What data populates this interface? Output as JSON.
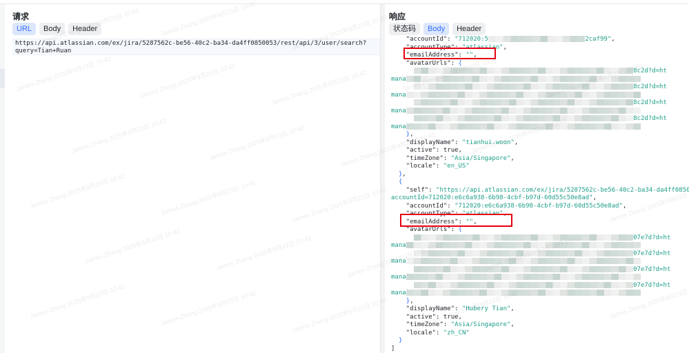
{
  "request": {
    "title": "请求",
    "tabs": [
      {
        "label": "URL",
        "active": true
      },
      {
        "label": "Body",
        "active": false
      },
      {
        "label": "Header",
        "active": false
      }
    ],
    "url_lines": [
      "https://api.atlassian.com/ex/jira/5287562c-be56-40c2-ba34-da4ff0850053/rest/api/3/user/search?",
      "query=Tian+Ruan"
    ]
  },
  "response": {
    "title": "响应",
    "tabs": [
      {
        "label": "状态码",
        "active": false
      },
      {
        "label": "Body",
        "active": true
      },
      {
        "label": "Header",
        "active": false
      }
    ],
    "lines": [
      {
        "id": "l1",
        "indent": "    ",
        "parts": [
          {
            "c": "key",
            "t": "\"accountId\": "
          },
          {
            "c": "str",
            "t": "\"712020:5"
          },
          {
            "c": "blur",
            "t": "xxxxxxxxxxxxxxxxxxxxxxxxxx"
          },
          {
            "c": "str",
            "t": "2caf99\""
          },
          {
            "c": "punc",
            "t": ","
          }
        ]
      },
      {
        "id": "l2",
        "indent": "    ",
        "parts": [
          {
            "c": "key",
            "t": "\"accountType\": "
          },
          {
            "c": "str",
            "t": "\"atlassian\""
          },
          {
            "c": "punc",
            "t": ","
          }
        ]
      },
      {
        "id": "l3",
        "indent": "    ",
        "parts": [
          {
            "c": "key",
            "t": "\"emailAddress\": "
          },
          {
            "c": "str",
            "t": "\"\""
          },
          {
            "c": "punc",
            "t": ","
          }
        ]
      },
      {
        "id": "l4",
        "indent": "    ",
        "parts": [
          {
            "c": "key",
            "t": "\"avatarUrls\": "
          },
          {
            "c": "brace",
            "t": "{"
          }
        ]
      },
      {
        "id": "l5",
        "indent": "      ",
        "parts": [
          {
            "c": "blur",
            "t": "xxxxxxxxxxxxxxxxxxxxxxxxxxxxxxxxxxxxxxxxxxxxxxxxxxxxxxxxxxx"
          },
          {
            "c": "str",
            "t": "8c2d?d=ht"
          }
        ]
      },
      {
        "id": "l6",
        "indent": "",
        "parts": [
          {
            "c": "str",
            "t": "mana"
          },
          {
            "c": "blur",
            "t": "xxxxxxxxxxxxxxxxxxxxxxxxxxxxxxxxxxxxxxxxxxxxxxxxxxxxxxxxxxxxxxx"
          }
        ]
      },
      {
        "id": "l7",
        "indent": "      ",
        "parts": [
          {
            "c": "blur",
            "t": "xxxxxxxxxxxxxxxxxxxxxxxxxxxxxxxxxxxxxxxxxxxxxxxxxxxxxxxxxxx"
          },
          {
            "c": "str",
            "t": "8c2d?d=ht"
          }
        ]
      },
      {
        "id": "l8",
        "indent": "",
        "parts": [
          {
            "c": "str",
            "t": "mana"
          },
          {
            "c": "blur",
            "t": "xxxxxxxxxxxxxxxxxxxxxxxxxxxxxxxxxxxxxxxxxxxxxxxxxxxxxxxxxxxxxxx"
          }
        ]
      },
      {
        "id": "l9",
        "indent": "      ",
        "parts": [
          {
            "c": "blur",
            "t": "xxxxxxxxxxxxxxxxxxxxxxxxxxxxxxxxxxxxxxxxxxxxxxxxxxxxxxxxxxx"
          },
          {
            "c": "str",
            "t": "8c2d?d=ht"
          }
        ]
      },
      {
        "id": "l10",
        "indent": "",
        "parts": [
          {
            "c": "str",
            "t": "mana"
          },
          {
            "c": "blur",
            "t": "xxxxxxxxxxxxxxxxxxxxxxxxxxxxxxxxxxxxxxxxxxxxxxxxxxxxxxxxxxxxxxx"
          }
        ]
      },
      {
        "id": "l11",
        "indent": "      ",
        "parts": [
          {
            "c": "blur",
            "t": "xxxxxxxxxxxxxxxxxxxxxxxxxxxxxxxxxxxxxxxxxxxxxxxxxxxxxxxxxxx"
          },
          {
            "c": "str",
            "t": "8c2d?d=ht"
          }
        ]
      },
      {
        "id": "l12",
        "indent": "",
        "parts": [
          {
            "c": "str",
            "t": "mana"
          },
          {
            "c": "blur",
            "t": "xxxxxxxxxxxxxxxxxxxxxxxxxxxxxxxxxxxxxxxxxxxxxxxxxxxxxxxxxxxxxxx"
          }
        ]
      },
      {
        "id": "l13",
        "indent": "    ",
        "parts": [
          {
            "c": "brace",
            "t": "}"
          },
          {
            "c": "punc",
            "t": ","
          }
        ]
      },
      {
        "id": "l14",
        "indent": "    ",
        "parts": [
          {
            "c": "key",
            "t": "\"displayName\": "
          },
          {
            "c": "str",
            "t": "\"tianhui.woon\""
          },
          {
            "c": "punc",
            "t": ","
          }
        ]
      },
      {
        "id": "l15",
        "indent": "    ",
        "parts": [
          {
            "c": "key",
            "t": "\"active\": "
          },
          {
            "c": "punc",
            "t": "true,"
          }
        ]
      },
      {
        "id": "l16",
        "indent": "    ",
        "parts": [
          {
            "c": "key",
            "t": "\"timeZone\": "
          },
          {
            "c": "str",
            "t": "\"Asia/Singapore\""
          },
          {
            "c": "punc",
            "t": ","
          }
        ]
      },
      {
        "id": "l17",
        "indent": "    ",
        "parts": [
          {
            "c": "key",
            "t": "\"locale\": "
          },
          {
            "c": "str",
            "t": "\"en_US\""
          }
        ]
      },
      {
        "id": "l18",
        "indent": "  ",
        "parts": [
          {
            "c": "brace",
            "t": "}"
          },
          {
            "c": "punc",
            "t": ","
          }
        ]
      },
      {
        "id": "l19",
        "indent": "  ",
        "parts": [
          {
            "c": "brace",
            "t": "{"
          }
        ]
      },
      {
        "id": "l20",
        "indent": "    ",
        "parts": [
          {
            "c": "key",
            "t": "\"self\": "
          },
          {
            "c": "str",
            "t": "\"https://api.atlassian.com/ex/jira/5287562c-be56-40c2-ba34-da4ff0850053/rest"
          }
        ]
      },
      {
        "id": "l21",
        "indent": "",
        "parts": [
          {
            "c": "str",
            "t": "accountId=712020:e6c6a938-6b98-4cbf-b97d-60d55c50e8ad\""
          },
          {
            "c": "punc",
            "t": ","
          }
        ]
      },
      {
        "id": "l22",
        "indent": "    ",
        "parts": [
          {
            "c": "key",
            "t": "\"accountId\": "
          },
          {
            "c": "str",
            "t": "\"712020:e6c6a938-6b98-4cbf-b97d-60d55c50e8ad\""
          },
          {
            "c": "punc",
            "t": ","
          }
        ]
      },
      {
        "id": "l23",
        "indent": "    ",
        "parts": [
          {
            "c": "key",
            "t": "\"accountType\": "
          },
          {
            "c": "str",
            "t": "\"atlassian\""
          },
          {
            "c": "punc",
            "t": ","
          }
        ]
      },
      {
        "id": "l24",
        "indent": "    ",
        "parts": [
          {
            "c": "key",
            "t": "\"emailAddress\": "
          },
          {
            "c": "str",
            "t": "\"\""
          },
          {
            "c": "punc",
            "t": ","
          }
        ]
      },
      {
        "id": "l25",
        "indent": "    ",
        "parts": [
          {
            "c": "key",
            "t": "\"avatarUrls\": "
          },
          {
            "c": "brace",
            "t": "{"
          }
        ]
      },
      {
        "id": "l26",
        "indent": "      ",
        "parts": [
          {
            "c": "blur",
            "t": "xxxxxxxxxxxxxxxxxxxxxxxxxxxxxxxxxxxxxxxxxxxxxxxxxxxxxxxxxxx"
          },
          {
            "c": "str",
            "t": "07e7d?d=ht"
          }
        ]
      },
      {
        "id": "l27",
        "indent": "",
        "parts": [
          {
            "c": "str",
            "t": "mana"
          },
          {
            "c": "blur",
            "t": "xxxxxxxxxxxxxxxxxxxxxxxxxxxxxxxxxxxxxxxxxxxxxxxxxxxxxxxxxxxxxxx"
          }
        ]
      },
      {
        "id": "l28",
        "indent": "      ",
        "parts": [
          {
            "c": "blur",
            "t": "xxxxxxxxxxxxxxxxxxxxxxxxxxxxxxxxxxxxxxxxxxxxxxxxxxxxxxxxxxx"
          },
          {
            "c": "str",
            "t": "07e7d?d=ht"
          }
        ]
      },
      {
        "id": "l29",
        "indent": "",
        "parts": [
          {
            "c": "str",
            "t": "mana"
          },
          {
            "c": "blur",
            "t": "xxxxxxxxxxxxxxxxxxxxxxxxxxxxxxxxxxxxxxxxxxxxxxxxxxxxxxxxxxxxxxx"
          }
        ]
      },
      {
        "id": "l30",
        "indent": "      ",
        "parts": [
          {
            "c": "blur",
            "t": "xxxxxxxxxxxxxxxxxxxxxxxxxxxxxxxxxxxxxxxxxxxxxxxxxxxxxxxxxxx"
          },
          {
            "c": "str",
            "t": "07e7d?d=ht"
          }
        ]
      },
      {
        "id": "l31",
        "indent": "",
        "parts": [
          {
            "c": "str",
            "t": "mana"
          },
          {
            "c": "blur",
            "t": "xxxxxxxxxxxxxxxxxxxxxxxxxxxxxxxxxxxxxxxxxxxxxxxxxxxxxxxxxxxxxxx"
          }
        ]
      },
      {
        "id": "l32",
        "indent": "      ",
        "parts": [
          {
            "c": "blur",
            "t": "xxxxxxxxxxxxxxxxxxxxxxxxxxxxxxxxxxxxxxxxxxxxxxxxxxxxxxxxxxx"
          },
          {
            "c": "str",
            "t": "07e7d?d=ht"
          }
        ]
      },
      {
        "id": "l33",
        "indent": "",
        "parts": [
          {
            "c": "str",
            "t": "mana"
          },
          {
            "c": "blur",
            "t": "xxxxxxxxxxxxxxxxxxxxxxxxxxxxxxxxxxxxxxxxxxxxxxxxxxxxxxxxxxxxxxx"
          }
        ]
      },
      {
        "id": "l34",
        "indent": "    ",
        "parts": [
          {
            "c": "brace",
            "t": "}"
          },
          {
            "c": "punc",
            "t": ","
          }
        ]
      },
      {
        "id": "l35",
        "indent": "    ",
        "parts": [
          {
            "c": "key",
            "t": "\"displayName\": "
          },
          {
            "c": "str",
            "t": "\"Hubery Tian\""
          },
          {
            "c": "punc",
            "t": ","
          }
        ]
      },
      {
        "id": "l36",
        "indent": "    ",
        "parts": [
          {
            "c": "key",
            "t": "\"active\": "
          },
          {
            "c": "punc",
            "t": "true,"
          }
        ]
      },
      {
        "id": "l37",
        "indent": "    ",
        "parts": [
          {
            "c": "key",
            "t": "\"timeZone\": "
          },
          {
            "c": "str",
            "t": "\"Asia/Singapore\""
          },
          {
            "c": "punc",
            "t": ","
          }
        ]
      },
      {
        "id": "l38",
        "indent": "    ",
        "parts": [
          {
            "c": "key",
            "t": "\"locale\": "
          },
          {
            "c": "str",
            "t": "\"zh_CN\""
          }
        ]
      },
      {
        "id": "l39",
        "indent": "  ",
        "parts": [
          {
            "c": "brace",
            "t": "}"
          }
        ]
      },
      {
        "id": "l40",
        "indent": "",
        "parts": [
          {
            "c": "punc",
            "t": "]"
          }
        ]
      }
    ]
  },
  "watermark_text": "James Zhang 2025年9月23日 10:42",
  "colors": {
    "accent": "#3370ff",
    "string": "#1e9e8a",
    "highlight": "#e60012"
  }
}
